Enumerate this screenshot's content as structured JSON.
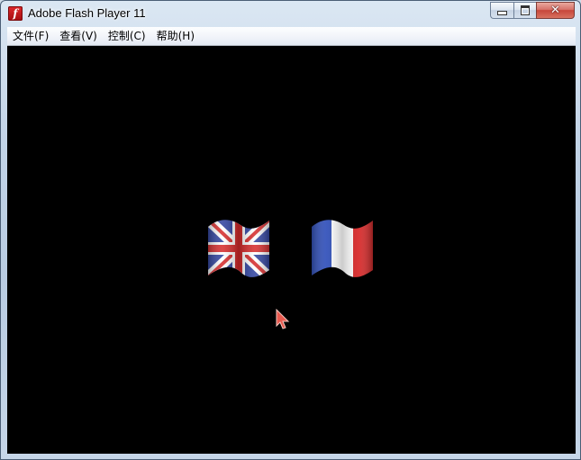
{
  "window": {
    "title": "Adobe Flash Player 11",
    "icon": "flash-player-icon"
  },
  "caption_buttons": {
    "minimize_icon": "minimize-icon",
    "maximize_icon": "maximize-icon",
    "close_icon": "close-icon",
    "close_glyph": "✕"
  },
  "menubar": {
    "items": [
      {
        "label": "文件(F)"
      },
      {
        "label": "查看(V)"
      },
      {
        "label": "控制(C)"
      },
      {
        "label": "帮助(H)"
      }
    ]
  },
  "stage": {
    "background": "#000000",
    "flags": [
      {
        "icon": "uk-flag-icon",
        "colors": [
          "#2b3f9e",
          "#ffffff",
          "#d62828"
        ]
      },
      {
        "icon": "france-flag-icon",
        "colors": [
          "#2b4bb8",
          "#ffffff",
          "#d62020"
        ]
      }
    ],
    "cursor_icon": "pointer-cursor-icon"
  }
}
